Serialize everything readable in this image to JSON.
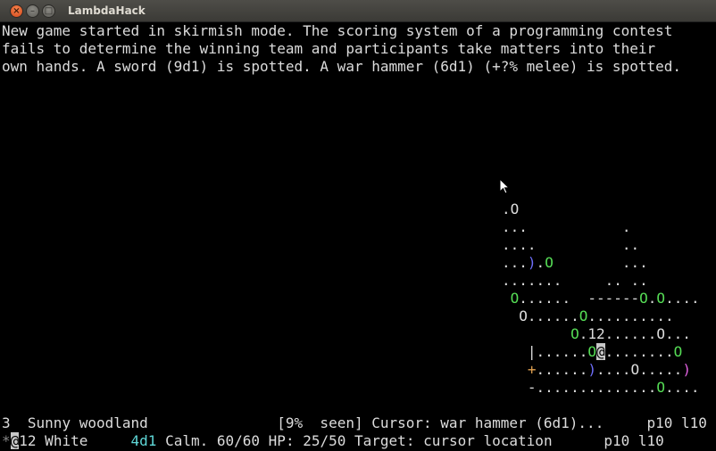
{
  "window": {
    "title": "LambdaHack",
    "close_glyph": "×",
    "minimize_glyph": "–",
    "maximize_glyph": "□"
  },
  "messages": [
    "New game started in skirmish mode. The scoring system of a programming contest",
    "fails to determine the winning team and participants take matters into their",
    "own hands. A sword (9d1) is spotted. A war hammer (6d1) (+?% melee) is spotted."
  ],
  "map": {
    "rows": [
      [
        {
          "t": ".",
          "c": ""
        },
        {
          "t": "O",
          "c": ""
        }
      ],
      [
        {
          "t": "...",
          "c": ""
        },
        {
          "t": "           ",
          "c": ""
        },
        {
          "t": ".",
          "c": ""
        }
      ],
      [
        {
          "t": "....",
          "c": ""
        },
        {
          "t": "          ",
          "c": ""
        },
        {
          "t": "..",
          "c": ""
        }
      ],
      [
        {
          "t": "...",
          "c": ""
        },
        {
          "t": ")",
          "c": "b"
        },
        {
          "t": ".",
          "c": ""
        },
        {
          "t": "O",
          "c": "g"
        },
        {
          "t": "        ",
          "c": ""
        },
        {
          "t": "...",
          "c": ""
        }
      ],
      [
        {
          "t": ".......",
          "c": ""
        },
        {
          "t": "     ",
          "c": ""
        },
        {
          "t": ".. ..",
          "c": ""
        }
      ],
      [
        {
          "t": " ",
          "c": ""
        },
        {
          "t": "O",
          "c": "g"
        },
        {
          "t": "......  ------",
          "c": ""
        },
        {
          "t": "O",
          "c": "g"
        },
        {
          "t": ".",
          "c": ""
        },
        {
          "t": "O",
          "c": "g"
        },
        {
          "t": "....",
          "c": ""
        }
      ],
      [
        {
          "t": "  O......",
          "c": ""
        },
        {
          "t": "O",
          "c": "g"
        },
        {
          "t": "..........",
          "c": ""
        }
      ],
      [
        {
          "t": "        ",
          "c": ""
        },
        {
          "t": "O",
          "c": "g"
        },
        {
          "t": ".12......O...",
          "c": ""
        }
      ],
      [
        {
          "t": "   |......",
          "c": ""
        },
        {
          "t": "O",
          "c": "g"
        },
        {
          "t": "@",
          "c": "hl"
        },
        {
          "t": "........",
          "c": ""
        },
        {
          "t": "O",
          "c": "g"
        }
      ],
      [
        {
          "t": "   ",
          "c": ""
        },
        {
          "t": "+",
          "c": "o"
        },
        {
          "t": "......",
          "c": ""
        },
        {
          "t": ")",
          "c": "b"
        },
        {
          "t": "....O.....",
          "c": ""
        },
        {
          "t": ")",
          "c": "m"
        }
      ],
      [
        {
          "t": "   -..............",
          "c": ""
        },
        {
          "t": "O",
          "c": "g"
        },
        {
          "t": "....",
          "c": ""
        }
      ]
    ]
  },
  "status": {
    "level_number": "3",
    "level_name": "Sunny woodland",
    "seen": "[9%  seen]",
    "cursor_text": "Cursor: war hammer (6d1)...",
    "page_top": "p10 l10",
    "selected_marker": "*",
    "leader_glyph": "@",
    "leader_rest": "12 White",
    "damage": "4d1",
    "calm": "Calm. 60/60",
    "hp": "HP: 25/50",
    "target": "Target: cursor location",
    "page_bottom": "p10 l10"
  }
}
